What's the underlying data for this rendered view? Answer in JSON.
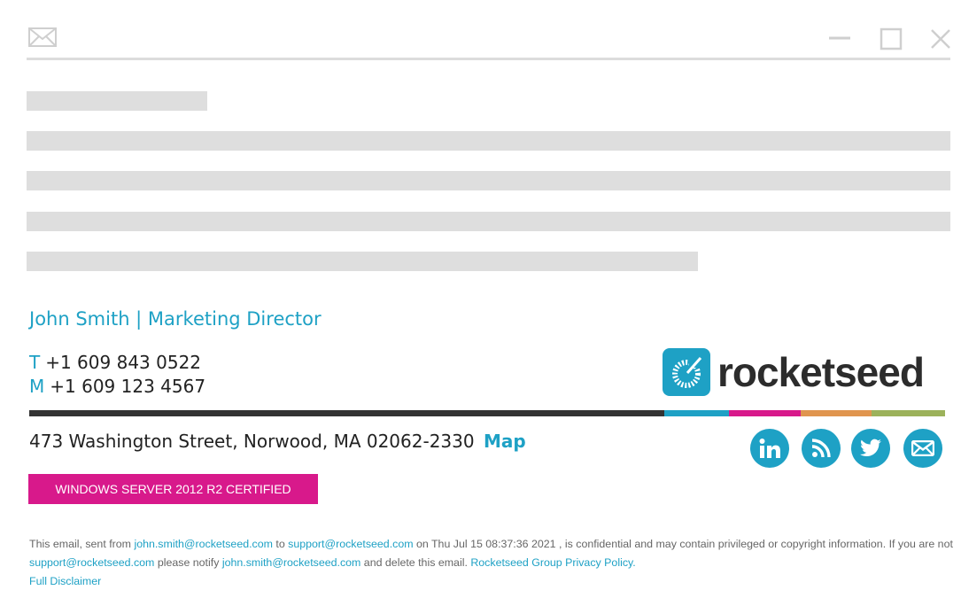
{
  "window": {
    "icons": {
      "mail": "envelope-icon",
      "minimize": "minimize-icon",
      "maximize": "maximize-icon",
      "close": "close-icon"
    }
  },
  "signature": {
    "name_title": "John Smith | Marketing Director",
    "phone_t_label": "T",
    "phone_t": "+1 609 843 0522",
    "phone_m_label": "M",
    "phone_m": "+1 609 123 4567",
    "address": "473 Washington Street, Norwood, MA 02062-2330",
    "map_link": "Map",
    "certification": "WINDOWS SERVER 2012 R2 CERTIFIED",
    "logo_text": "rocketseed",
    "social_icons": [
      "linkedin-icon",
      "rss-icon",
      "twitter-icon",
      "mail-icon"
    ]
  },
  "disclaimer": {
    "p1": "This email, sent from ",
    "sender": "john.smith@rocketseed.com",
    "p2": " to ",
    "recipient": "support@rocketseed.com",
    "p3": " on Thu Jul 15 08:37:36 2021 , is confidential and may contain privileged or copyright information. If you are not ",
    "recipient2": "support@rocketseed.com",
    "p4": " please notify ",
    "sender2": "john.smith@rocketseed.com",
    "p5": " and delete this email. ",
    "privacy_link": "Rocketseed Group Privacy Policy.",
    "full_disclaimer_link": "Full Disclaimer"
  },
  "colors": {
    "accent": "#1ea1c5",
    "magenta": "#d8198b",
    "orange": "#e0954f",
    "olive": "#9cb25b",
    "dark": "#333333",
    "placeholder": "#dedede"
  }
}
